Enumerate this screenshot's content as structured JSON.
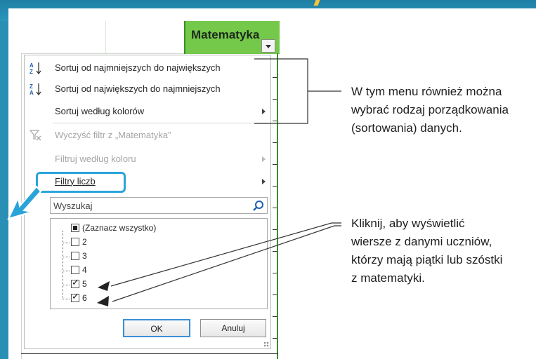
{
  "sheet": {
    "column_header": "Matematyka"
  },
  "menu": {
    "sort_asc": "Sortuj od najmniejszych do największych",
    "sort_desc": "Sortuj od największych do najmniejszych",
    "sort_by_color": "Sortuj według kolorów",
    "clear_filter": "Wyczyść filtr z „Matematyka”",
    "filter_by_color": "Filtruj według koloru",
    "number_filters": "Filtry liczb",
    "search_placeholder": "Wyszukaj",
    "list_items": [
      {
        "label": "(Zaznacz wszystko)",
        "state": "partial"
      },
      {
        "label": "2",
        "state": "unchecked"
      },
      {
        "label": "3",
        "state": "unchecked"
      },
      {
        "label": "4",
        "state": "unchecked"
      },
      {
        "label": "5",
        "state": "checked"
      },
      {
        "label": "6",
        "state": "checked"
      }
    ],
    "ok_label": "OK",
    "cancel_label": "Anuluj"
  },
  "annotations": {
    "sort_note": [
      "W tym menu również można",
      "wybrać rodzaj porządkowania",
      "(sortowania) danych."
    ],
    "filter_note": [
      "Kliknij, aby wyświetlić",
      "wiersze z danymi uczniów,",
      "którzy mają piątki lub szóstki",
      "z matematyki."
    ]
  },
  "colors": {
    "header_green": "#74c94a",
    "highlight_blue": "#29a5db",
    "background_teal": "#2a8fb4"
  }
}
